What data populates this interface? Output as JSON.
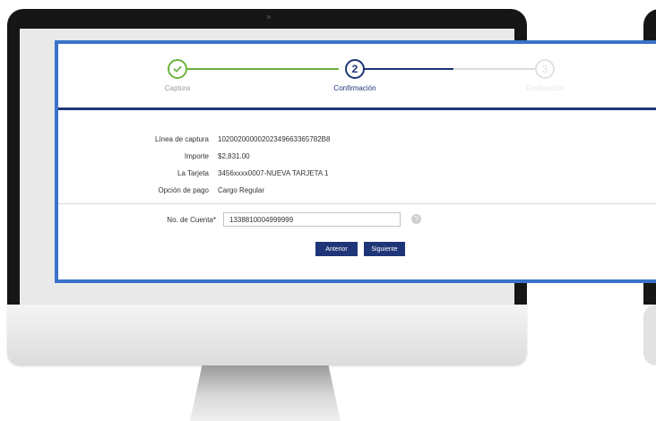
{
  "stepper": {
    "steps": [
      {
        "label": "Captura",
        "number": "",
        "state": "done"
      },
      {
        "label": "Confirmación",
        "number": "2",
        "state": "active"
      },
      {
        "label": "Finalización",
        "number": "3",
        "state": "pending"
      }
    ]
  },
  "details": [
    {
      "label": "Línea de captura",
      "value": "10200200000202349663365782B8"
    },
    {
      "label": "Importe",
      "value": "$2,831.00"
    },
    {
      "label": "La Tarjeta",
      "value": "3456xxxx0007-NUEVA TARJETA 1"
    },
    {
      "label": "Opción de pago",
      "value": "Cargo Regular"
    }
  ],
  "account": {
    "label": "No. de Cuenta*",
    "value": "1338810004999999"
  },
  "buttons": {
    "previous": "Anterior",
    "next": "Siguiente"
  },
  "colors": {
    "accent_green": "#6db33f",
    "navy": "#1e3577",
    "callout_border": "#3a72c9"
  },
  "icons": {
    "step_done": "check-icon",
    "help": "question-icon"
  }
}
